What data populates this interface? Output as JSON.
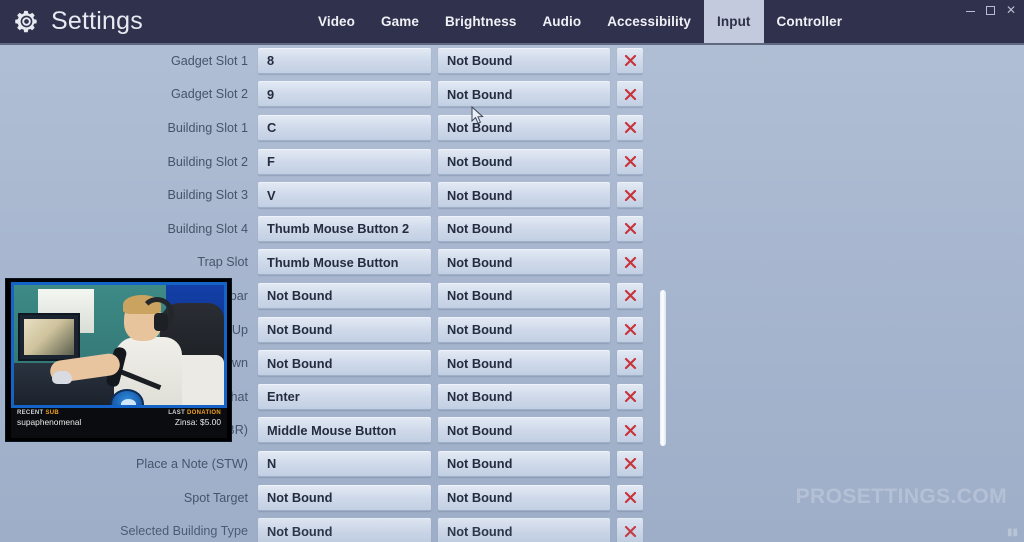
{
  "window": {
    "title": "Settings",
    "gear_icon": "gear-icon",
    "controls": [
      {
        "name": "minimize",
        "glyph": "–"
      },
      {
        "name": "maximize",
        "glyph": "□"
      },
      {
        "name": "close",
        "glyph": "✕"
      }
    ]
  },
  "nav": {
    "tabs": [
      {
        "label": "Video",
        "active": false
      },
      {
        "label": "Game",
        "active": false
      },
      {
        "label": "Brightness",
        "active": false
      },
      {
        "label": "Audio",
        "active": false
      },
      {
        "label": "Accessibility",
        "active": false
      },
      {
        "label": "Input",
        "active": true
      },
      {
        "label": "Controller",
        "active": false
      }
    ],
    "active_tab": "Input"
  },
  "bindings": {
    "clear_icon": "x-icon",
    "rows": [
      {
        "label": "Gadget Slot 1",
        "primary": "8",
        "secondary": "Not Bound"
      },
      {
        "label": "Gadget Slot 2",
        "primary": "9",
        "secondary": "Not Bound"
      },
      {
        "label": "Building Slot 1",
        "primary": "C",
        "secondary": "Not Bound"
      },
      {
        "label": "Building Slot 2",
        "primary": "F",
        "secondary": "Not Bound"
      },
      {
        "label": "Building Slot 3",
        "primary": "V",
        "secondary": "Not Bound"
      },
      {
        "label": "Building Slot 4",
        "primary": "Thumb Mouse Button 2",
        "secondary": "Not Bound"
      },
      {
        "label": "Trap Slot",
        "primary": "Thumb Mouse Button",
        "secondary": "Not Bound"
      },
      {
        "label": "Toggle Quickbar",
        "primary": "Not Bound",
        "secondary": "Not Bound"
      },
      {
        "label": "Next Slot Up",
        "primary": "Not Bound",
        "secondary": "Not Bound"
      },
      {
        "label": "Next Slot Down",
        "primary": "Not Bound",
        "secondary": "Not Bound"
      },
      {
        "label": "Chat",
        "primary": "Enter",
        "secondary": "Not Bound"
      },
      {
        "label": "Place a Note (BR)",
        "primary": "Middle Mouse Button",
        "secondary": "Not Bound"
      },
      {
        "label": "Place a Note (STW)",
        "primary": "N",
        "secondary": "Not Bound"
      },
      {
        "label": "Spot Target",
        "primary": "Not Bound",
        "secondary": "Not Bound"
      },
      {
        "label": "Selected Building Type",
        "primary": "Not Bound",
        "secondary": "Not Bound"
      }
    ]
  },
  "scrollbar": {
    "name": "vertical-scrollbar"
  },
  "webcam": {
    "recent_sub_label_1": "RECENT",
    "recent_sub_label_2": "SUB",
    "recent_sub_value": "supaphenomenal",
    "last_donation_label_1": "LAST",
    "last_donation_label_2": "DONATION",
    "last_donation_value": "Zinsa: $5.00"
  },
  "watermark": {
    "text": "PROSETTINGS.COM"
  },
  "colors": {
    "titlebar": "#30314c",
    "active_tab_bg": "#c4cadd",
    "page_bg": "#a8b7cf",
    "field_bg": "#cfd9ea",
    "clear_red": "#c8343c",
    "label_text": "#46536b"
  }
}
